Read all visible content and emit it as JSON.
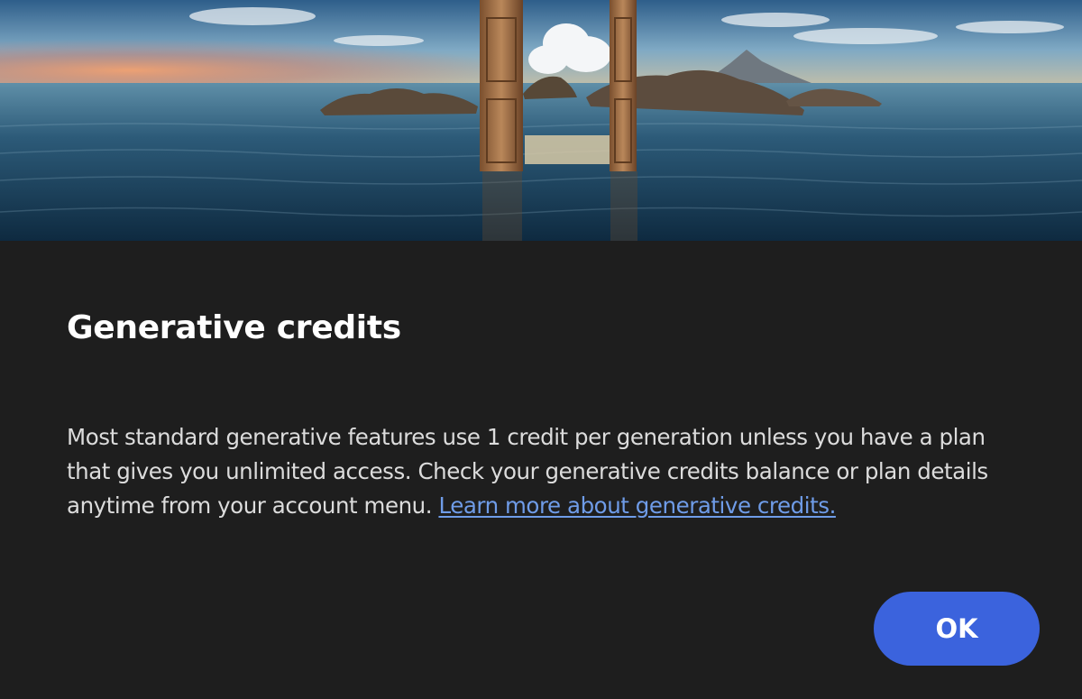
{
  "dialog": {
    "hero_image": "ocean-doors-illustration",
    "title": "Generative credits",
    "body_text": "Most standard generative features use 1 credit per generation unless you have a plan that gives you unlimited access. Check your generative credits balance or plan details anytime from your account menu. ",
    "learn_more_link": "Learn more about generative credits.",
    "ok_button": "OK"
  },
  "colors": {
    "background": "#1e1e1e",
    "title": "#ffffff",
    "body": "#dcdcdc",
    "link": "#6f9ce8",
    "button": "#3b63dd"
  }
}
